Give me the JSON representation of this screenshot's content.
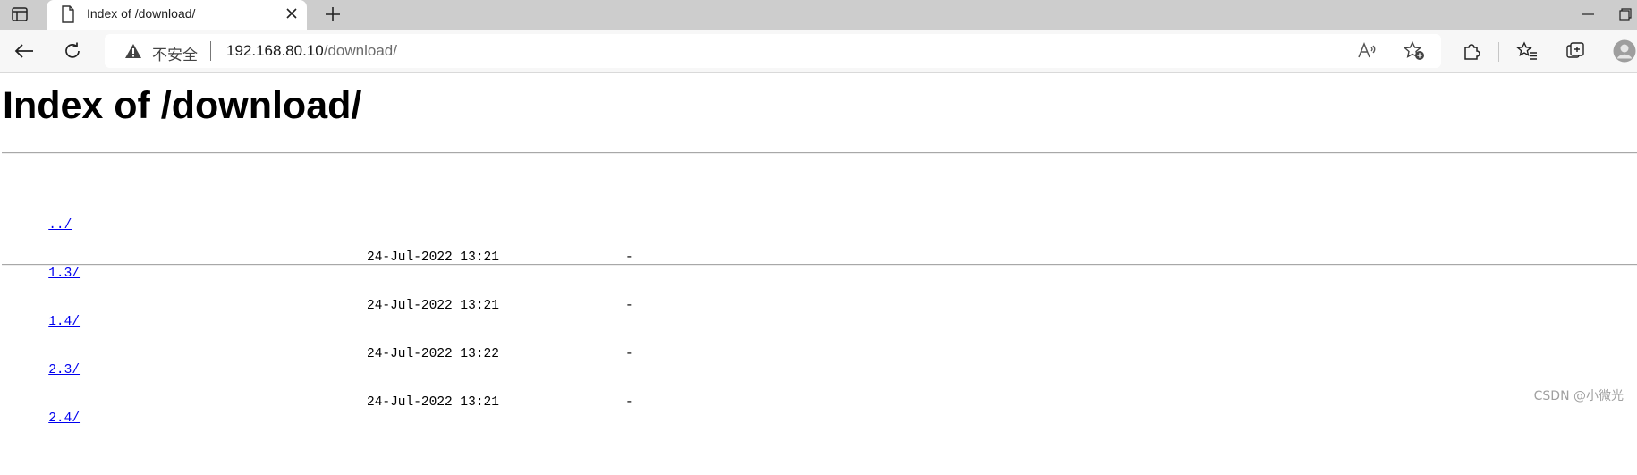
{
  "browser": {
    "tab_title": "Index of /download/",
    "address": {
      "security_label": "不安全",
      "url_host": "192.168.80.10",
      "url_path": "/download/"
    }
  },
  "page": {
    "heading": "Index of /download/",
    "parent_link": "../",
    "entries": [
      {
        "name": "1.3/",
        "date": "24-Jul-2022 13:21",
        "size": "-"
      },
      {
        "name": "1.4/",
        "date": "24-Jul-2022 13:21",
        "size": "-"
      },
      {
        "name": "2.3/",
        "date": "24-Jul-2022 13:22",
        "size": "-"
      },
      {
        "name": "2.4/",
        "date": "24-Jul-2022 13:21",
        "size": "-"
      }
    ]
  },
  "watermark": "CSDN @小微光",
  "colors": {
    "link": "#0000ee",
    "tabstrip": "#cdcdcd",
    "toolbar": "#f7f7f7"
  },
  "icons": [
    "tab-actions-icon",
    "page-icon",
    "close-icon",
    "plus-icon",
    "minimize-icon",
    "restore-icon",
    "back-arrow-icon",
    "refresh-icon",
    "warning-icon",
    "read-aloud-icon",
    "add-favorite-icon",
    "extensions-icon",
    "favorites-icon",
    "collections-icon",
    "profile-icon"
  ]
}
